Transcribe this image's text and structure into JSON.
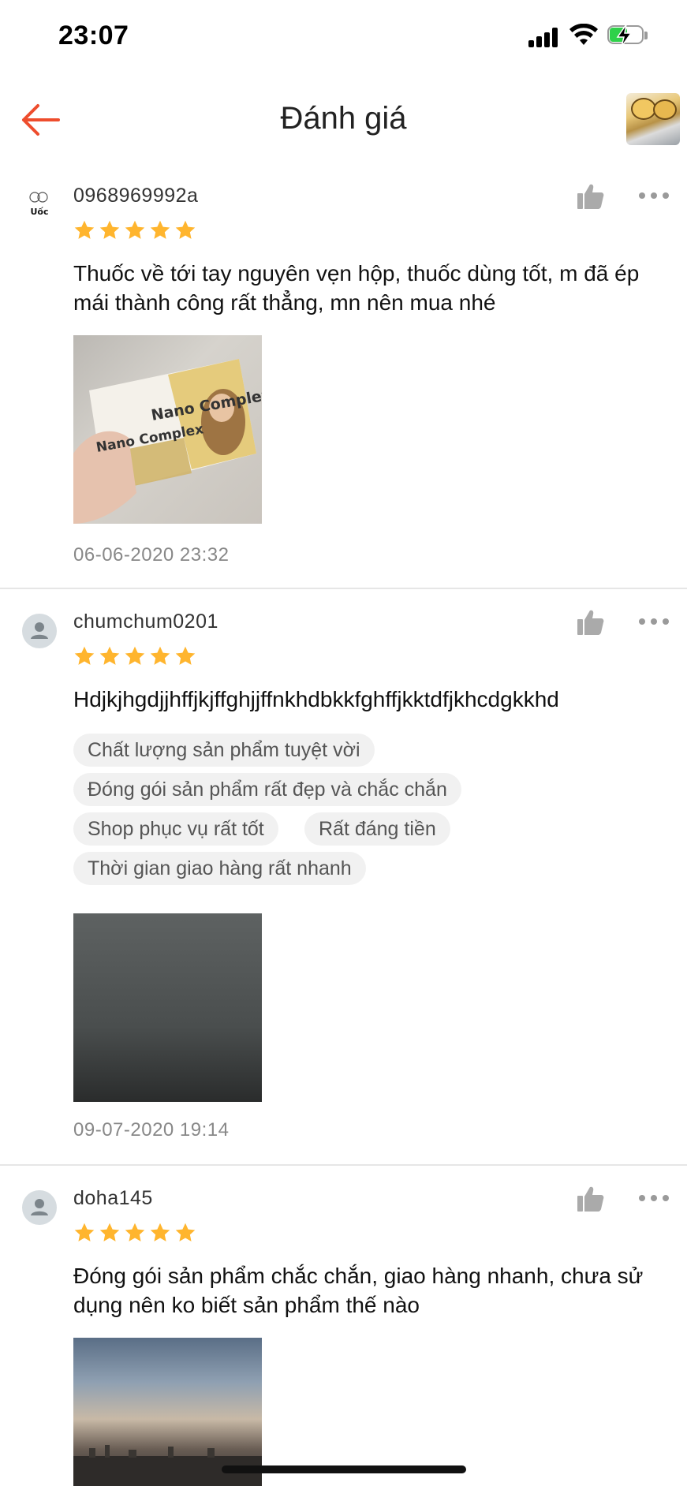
{
  "status_bar": {
    "time": "23:07"
  },
  "header": {
    "title": "Đánh giá"
  },
  "reviews": [
    {
      "username": "0968969992a",
      "rating": 5,
      "text": "Thuốc về tới tay nguyên vẹn hộp, thuốc dùng tốt, m đã ép mái thành công rất thẳng, mn nên mua nhé",
      "tags": [],
      "image_text": {
        "line1": "Nano Complex",
        "line2": "Nano Complex"
      },
      "date": "06-06-2020 23:32",
      "avatar_logo_text": "Uốc"
    },
    {
      "username": "chumchum0201",
      "rating": 5,
      "text": "Hdjkjhgdjjhffjkjffghjjffnkhdbkkfghffjkktdfjkhcdgkkhd",
      "tags": [
        "Chất lượng sản phẩm tuyệt vời",
        "Đóng gói sản phẩm rất đẹp và chắc chắn",
        "Shop phục vụ rất tốt",
        "Rất đáng tiền",
        "Thời gian giao hàng rất nhanh"
      ],
      "date": "09-07-2020 19:14"
    },
    {
      "username": "doha145",
      "rating": 5,
      "text": "Đóng gói sản phẩm chắc chắn, giao hàng nhanh, chưa sử dụng nên ko biết sản phẩm thế nào",
      "tags": [],
      "date": ""
    }
  ],
  "colors": {
    "accent": "#ee4d2d",
    "star": "#ffb52e",
    "tag_bg": "#f1f1f1",
    "divider": "#e6e6e6"
  },
  "icons": {
    "back": "arrow-left-icon",
    "like": "thumbs-up-icon",
    "more": "more-dots-icon",
    "star": "star-icon"
  }
}
